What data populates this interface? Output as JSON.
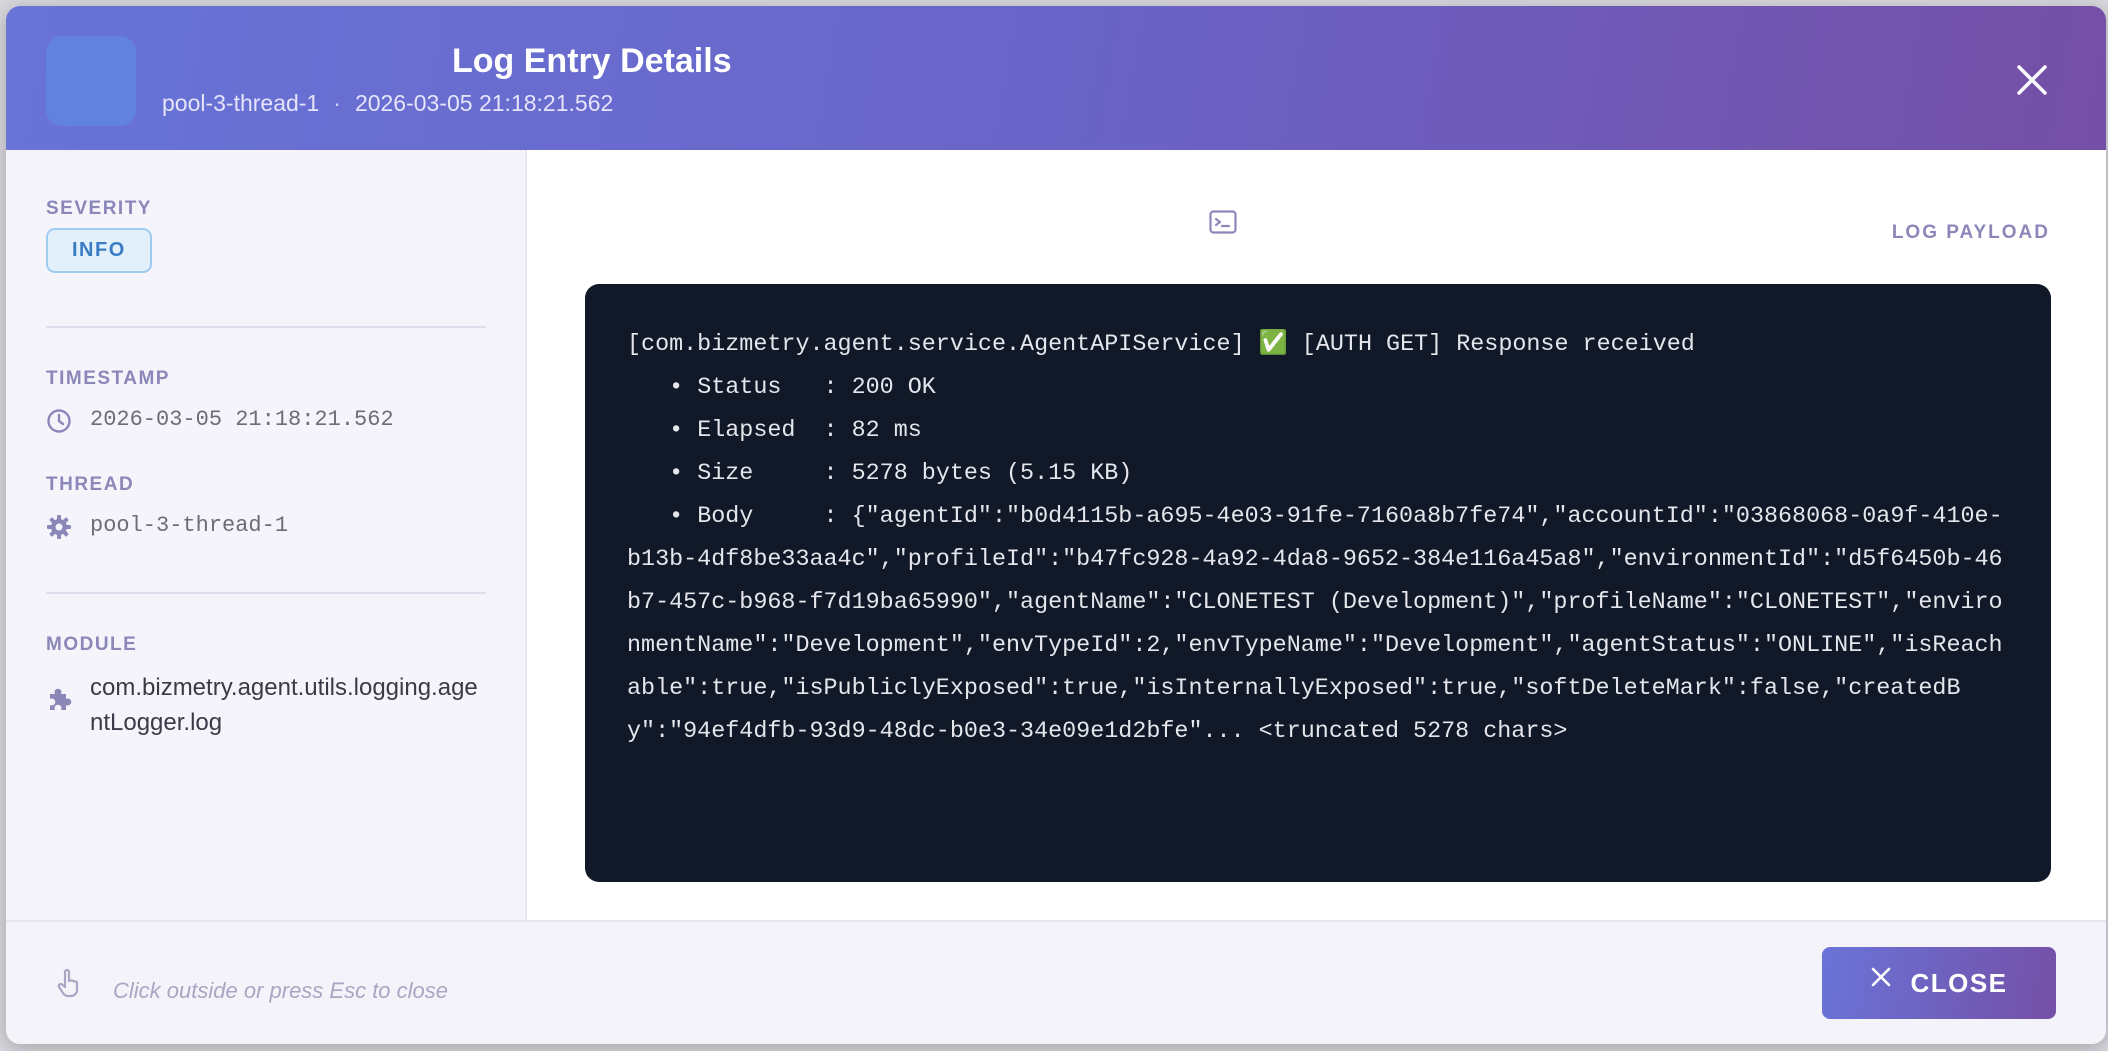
{
  "header": {
    "title": "Log Entry Details",
    "thread": "pool-3-thread-1",
    "separator": "·",
    "timestamp": "2026-03-05 21:18:21.562"
  },
  "sidebar": {
    "severity_label": "SEVERITY",
    "severity_value": "INFO",
    "timestamp_label": "TIMESTAMP",
    "timestamp_value": "2026-03-05 21:18:21.562",
    "thread_label": "THREAD",
    "thread_value": "pool-3-thread-1",
    "module_label": "MODULE",
    "module_value": "com.bizmetry.agent.utils.logging.agentLogger.log"
  },
  "main": {
    "payload_label": "LOG PAYLOAD",
    "payload_text": "[com.bizmetry.agent.service.AgentAPIService] ✅ [AUTH GET] Response received\n   • Status   : 200 OK\n   • Elapsed  : 82 ms\n   • Size     : 5278 bytes (5.15 KB)\n   • Body     : {\"agentId\":\"b0d4115b-a695-4e03-91fe-7160a8b7fe74\",\"accountId\":\"03868068-0a9f-410e-b13b-4df8be33aa4c\",\"profileId\":\"b47fc928-4a92-4da8-9652-384e116a45a8\",\"environmentId\":\"d5f6450b-46b7-457c-b968-f7d19ba65990\",\"agentName\":\"CLONETEST (Development)\",\"profileName\":\"CLONETEST\",\"environmentName\":\"Development\",\"envTypeId\":2,\"envTypeName\":\"Development\",\"agentStatus\":\"ONLINE\",\"isReachable\":true,\"isPubliclyExposed\":true,\"isInternallyExposed\":true,\"softDeleteMark\":false,\"createdBy\":\"94ef4dfb-93d9-48dc-b0e3-34e09e1d2bfe\"... <truncated 5278 chars>"
  },
  "footer": {
    "hint": "Click outside or press Esc to close",
    "close_label": "CLOSE"
  },
  "colors": {
    "header_gradient_start": "#6874d6",
    "header_gradient_end": "#744fa6",
    "terminal_bg": "#111827",
    "info_badge": "#3a7cc4"
  },
  "icons": [
    "close-icon",
    "clock-icon",
    "gear-icon",
    "puzzle-icon",
    "terminal-icon",
    "hand-pointer-icon"
  ]
}
